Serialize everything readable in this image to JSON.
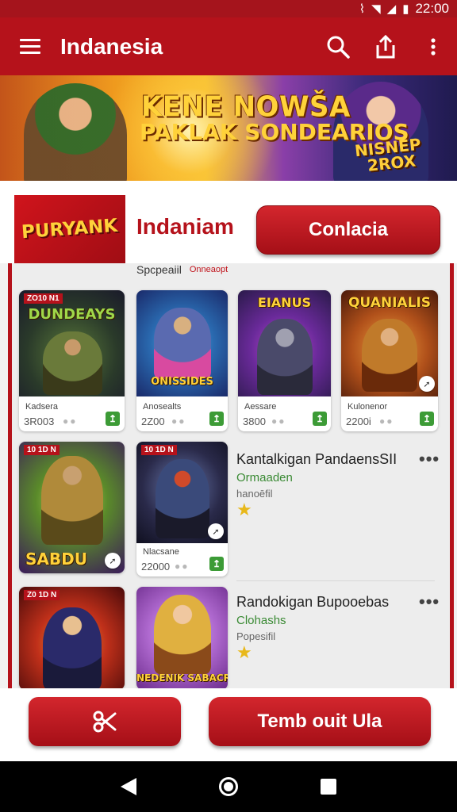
{
  "status_bar": {
    "time": "22:00",
    "icons": [
      "signal-icon",
      "wifi-icon",
      "cell-icon",
      "battery-icon"
    ]
  },
  "app_bar": {
    "title": "Indanesia",
    "icons": [
      "menu-icon",
      "search-icon",
      "share-icon",
      "more-vert-icon"
    ]
  },
  "banner": {
    "line1": "KENE NOWŠA",
    "line2": "PAKLAK SONDEARIOS",
    "badge_line1": "NISNEP",
    "badge_line2": "2ROX"
  },
  "publisher": {
    "logo_text": "PURYANK",
    "name": "Indaniam",
    "button_label": "Conlacia"
  },
  "tabs": {
    "first": "Spcpeaiil",
    "second": "Onneaopt"
  },
  "grid_cards": [
    {
      "badge": "ZO10 N1",
      "art_title": "DUNDEAYS",
      "name": "Kadsera",
      "count": "3R003"
    },
    {
      "badge": "",
      "art_title": "ONISSIDES",
      "name": "Anosealts",
      "count": "2Z00"
    },
    {
      "badge": "",
      "art_title": "EIANUS",
      "name": "Aessare",
      "count": "3800"
    },
    {
      "badge": "",
      "art_title": "QUANIALIS",
      "name": "Kulonenor",
      "count": "2200i"
    }
  ],
  "list_rows": [
    {
      "left_card": {
        "badge": "10 1D N",
        "art_title": "SABDU"
      },
      "mid_card": {
        "badge": "10 1D N",
        "name": "Nlacsane",
        "count": "22000"
      },
      "title": "Kantalkigan PandaensSII",
      "subtitle": "Ormaaden",
      "meta": "hanoēfil"
    },
    {
      "left_card": {
        "badge": "Z0 1D N",
        "art_title": ""
      },
      "mid_card": {
        "art_title": "NEDENIK SABACR"
      },
      "title": "Randokigan Bupooebas",
      "subtitle": "Clohashs",
      "meta": "Popesifil"
    }
  ],
  "bottom_actions": {
    "left_icon": "scissors-icon",
    "right_label": "Temb ouit Ula"
  },
  "colors": {
    "primary": "#b5121b",
    "primary_dark": "#a5141c",
    "success": "#3c9b36",
    "star": "#e8b81a"
  }
}
